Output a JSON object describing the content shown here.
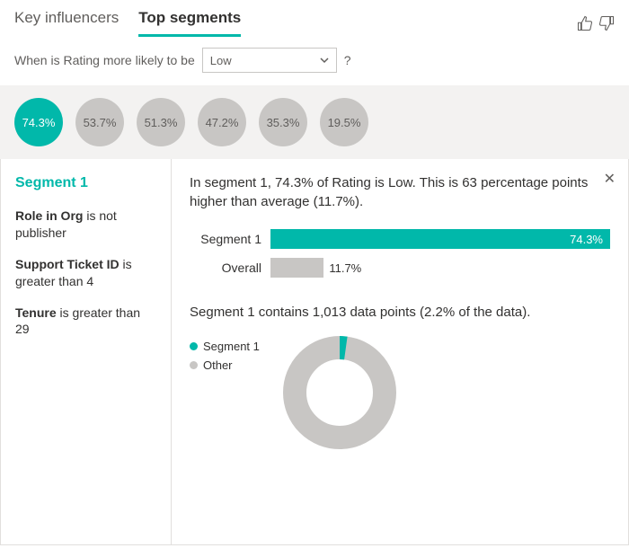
{
  "tabs": {
    "key_influencers": "Key influencers",
    "top_segments": "Top segments"
  },
  "question": {
    "prefix": "When is Rating more likely to be",
    "selected": "Low",
    "suffix": "?"
  },
  "segments": [
    {
      "label": "74.3%",
      "value": 74.3,
      "selected": true
    },
    {
      "label": "53.7%",
      "value": 53.7,
      "selected": false
    },
    {
      "label": "51.3%",
      "value": 51.3,
      "selected": false
    },
    {
      "label": "47.2%",
      "value": 47.2,
      "selected": false
    },
    {
      "label": "35.3%",
      "value": 35.3,
      "selected": false
    },
    {
      "label": "19.5%",
      "value": 19.5,
      "selected": false
    }
  ],
  "detail": {
    "title": "Segment 1",
    "conditions": [
      {
        "field": "Role in Org",
        "text": "is not publisher"
      },
      {
        "field": "Support Ticket ID",
        "text": "is greater than 4"
      },
      {
        "field": "Tenure",
        "text": "is greater than 29"
      }
    ],
    "summary": "In segment 1, 74.3% of Rating is Low. This is 63 percentage points higher than average (11.7%).",
    "points_text": "Segment 1 contains 1,013 data points (2.2% of the data).",
    "legend": {
      "segment": "Segment 1",
      "other": "Other"
    }
  },
  "chart_data": [
    {
      "type": "bar",
      "title": "",
      "xlabel": "",
      "ylabel": "",
      "categories": [
        "Segment 1",
        "Overall"
      ],
      "values": [
        74.3,
        11.7
      ],
      "value_labels": [
        "74.3%",
        "11.7%"
      ],
      "colors": [
        "#01b8aa",
        "#c8c6c4"
      ],
      "xlim": [
        0,
        100
      ]
    },
    {
      "type": "pie",
      "title": "",
      "series": [
        {
          "name": "Segment 1",
          "value": 2.2,
          "color": "#01b8aa"
        },
        {
          "name": "Other",
          "value": 97.8,
          "color": "#c8c6c4"
        }
      ],
      "style": "donut"
    }
  ]
}
